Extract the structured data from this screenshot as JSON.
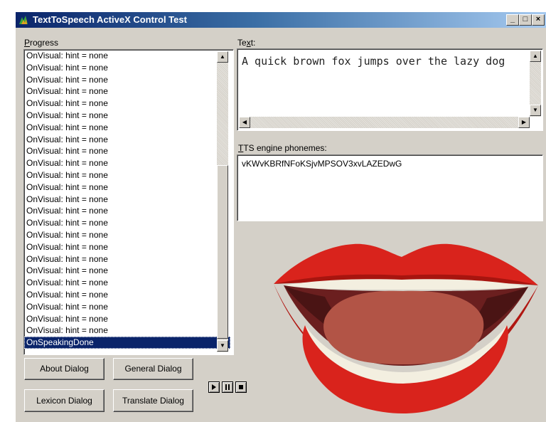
{
  "window": {
    "title": "TextToSpeech ActiveX Control Test",
    "title_icon": "app-icon",
    "controls": {
      "minimize": "_",
      "maximize": "□",
      "close": "×"
    }
  },
  "progress": {
    "label_prefix": "",
    "label_accel": "P",
    "label_rest": "rogress",
    "items": [
      "OnVisual: hint = none",
      "OnVisual: hint = none",
      "OnVisual: hint = none",
      "OnVisual: hint = none",
      "OnVisual: hint = none",
      "OnVisual: hint = none",
      "OnVisual: hint = none",
      "OnVisual: hint = none",
      "OnVisual: hint = none",
      "OnVisual: hint = none",
      "OnVisual: hint = none",
      "OnVisual: hint = none",
      "OnVisual: hint = none",
      "OnVisual: hint = none",
      "OnVisual: hint = none",
      "OnVisual: hint = none",
      "OnVisual: hint = none",
      "OnVisual: hint = none",
      "OnVisual: hint = none",
      "OnVisual: hint = none",
      "OnVisual: hint = none",
      "OnVisual: hint = none",
      "OnVisual: hint = none",
      "OnVisual: hint = none"
    ],
    "selected_item": "OnSpeakingDone"
  },
  "text": {
    "label_prefix": "Te",
    "label_accel": "x",
    "label_rest": "t:",
    "value": "A quick brown fox jumps over the lazy dog"
  },
  "phonemes": {
    "label_prefix": "",
    "label_accel": "T",
    "label_rest": "TS engine phonemes:",
    "value": "vKWvKBRfNFoKSjvMPSOV3xvLAZEDwG"
  },
  "buttons": {
    "about": "About Dialog",
    "general": "General Dialog",
    "lexicon": "Lexicon Dialog",
    "translate": "Translate Dialog"
  },
  "playback": {
    "play": "play-icon",
    "pause": "pause-icon",
    "stop": "stop-icon"
  },
  "colors": {
    "lips": "#d9231c",
    "lips_dark": "#b01712",
    "teeth": "#f3efe0",
    "mouth": "#6b1f1f",
    "tongue": "#b25446",
    "titlebar": "#0a246a"
  }
}
